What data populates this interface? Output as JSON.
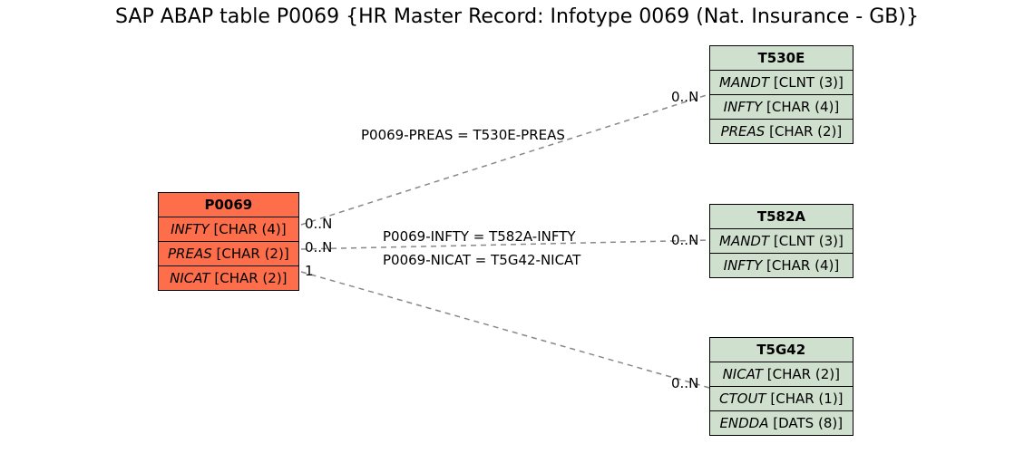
{
  "title": "SAP ABAP table P0069 {HR Master Record: Infotype 0069 (Nat. Insurance - GB)}",
  "tables": {
    "p0069": {
      "name": "P0069",
      "fields": [
        {
          "name": "INFTY",
          "type": "[CHAR (4)]"
        },
        {
          "name": "PREAS",
          "type": "[CHAR (2)]"
        },
        {
          "name": "NICAT",
          "type": "[CHAR (2)]"
        }
      ]
    },
    "t530e": {
      "name": "T530E",
      "fields": [
        {
          "name": "MANDT",
          "type": "[CLNT (3)]"
        },
        {
          "name": "INFTY",
          "type": "[CHAR (4)]"
        },
        {
          "name": "PREAS",
          "type": "[CHAR (2)]"
        }
      ]
    },
    "t582a": {
      "name": "T582A",
      "fields": [
        {
          "name": "MANDT",
          "type": "[CLNT (3)]"
        },
        {
          "name": "INFTY",
          "type": "[CHAR (4)]"
        }
      ]
    },
    "t5g42": {
      "name": "T5G42",
      "fields": [
        {
          "name": "NICAT",
          "type": "[CHAR (2)]"
        },
        {
          "name": "CTOUT",
          "type": "[CHAR (1)]"
        },
        {
          "name": "ENDDA",
          "type": "[DATS (8)]"
        }
      ]
    }
  },
  "relations": {
    "r1": {
      "label": "P0069-PREAS = T530E-PREAS",
      "leftCard": "0..N",
      "rightCard": "0..N"
    },
    "r2": {
      "label": "P0069-INFTY = T582A-INFTY",
      "leftCard": "0..N",
      "rightCard": "0..N"
    },
    "r3": {
      "label": "P0069-NICAT = T5G42-NICAT",
      "leftCard": "1",
      "rightCard": "0..N"
    }
  },
  "chart_data": {
    "type": "table",
    "title": "SAP ABAP table P0069 {HR Master Record: Infotype 0069 (Nat. Insurance - GB)}",
    "entities": [
      {
        "name": "P0069",
        "color": "#ff6e4a",
        "fields": [
          {
            "name": "INFTY",
            "type": "CHAR",
            "len": 4
          },
          {
            "name": "PREAS",
            "type": "CHAR",
            "len": 2
          },
          {
            "name": "NICAT",
            "type": "CHAR",
            "len": 2
          }
        ]
      },
      {
        "name": "T530E",
        "color": "#d0e0ce",
        "fields": [
          {
            "name": "MANDT",
            "type": "CLNT",
            "len": 3
          },
          {
            "name": "INFTY",
            "type": "CHAR",
            "len": 4
          },
          {
            "name": "PREAS",
            "type": "CHAR",
            "len": 2
          }
        ]
      },
      {
        "name": "T582A",
        "color": "#d0e0ce",
        "fields": [
          {
            "name": "MANDT",
            "type": "CLNT",
            "len": 3
          },
          {
            "name": "INFTY",
            "type": "CHAR",
            "len": 4
          }
        ]
      },
      {
        "name": "T5G42",
        "color": "#d0e0ce",
        "fields": [
          {
            "name": "NICAT",
            "type": "CHAR",
            "len": 2
          },
          {
            "name": "CTOUT",
            "type": "CHAR",
            "len": 1
          },
          {
            "name": "ENDDA",
            "type": "DATS",
            "len": 8
          }
        ]
      }
    ],
    "relations": [
      {
        "from": "P0069",
        "fromField": "PREAS",
        "fromCard": "0..N",
        "to": "T530E",
        "toField": "PREAS",
        "toCard": "0..N",
        "label": "P0069-PREAS = T530E-PREAS"
      },
      {
        "from": "P0069",
        "fromField": "INFTY",
        "fromCard": "0..N",
        "to": "T582A",
        "toField": "INFTY",
        "toCard": "0..N",
        "label": "P0069-INFTY = T582A-INFTY"
      },
      {
        "from": "P0069",
        "fromField": "NICAT",
        "fromCard": "1",
        "to": "T5G42",
        "toField": "NICAT",
        "toCard": "0..N",
        "label": "P0069-NICAT = T5G42-NICAT"
      }
    ]
  }
}
